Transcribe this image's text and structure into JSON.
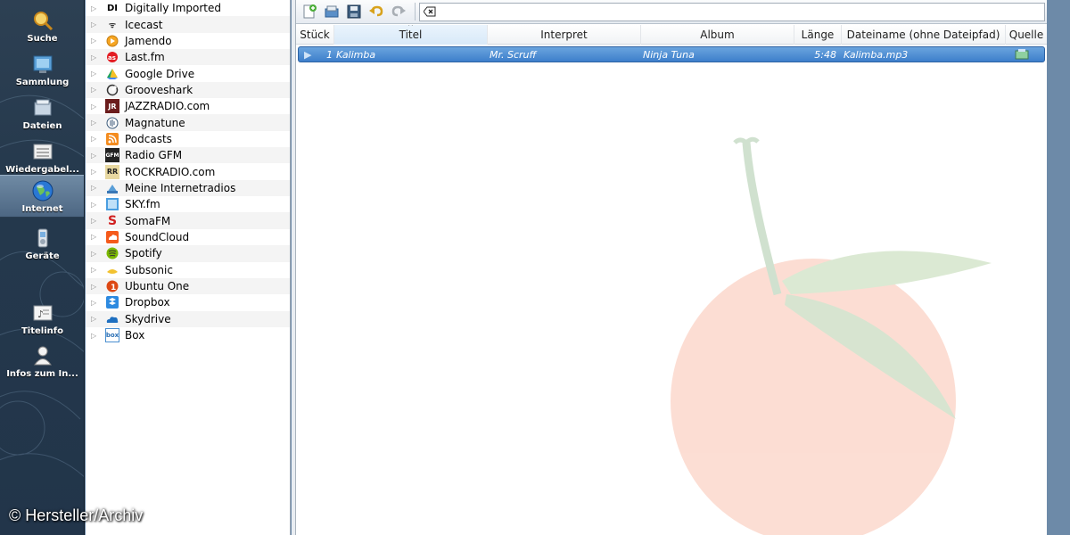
{
  "sidebar": {
    "items": [
      {
        "label": "Suche",
        "icon": "search-icon"
      },
      {
        "label": "Sammlung",
        "icon": "collection-icon"
      },
      {
        "label": "Dateien",
        "icon": "files-icon"
      },
      {
        "label": "Wiedergabel...",
        "icon": "playlist-icon"
      },
      {
        "label": "Internet",
        "icon": "globe-icon",
        "active": true
      },
      {
        "label": "Geräte",
        "icon": "device-icon"
      },
      {
        "label": "Titelinfo",
        "icon": "song-info-icon"
      },
      {
        "label": "Infos zum In...",
        "icon": "artist-info-icon"
      }
    ]
  },
  "tree": {
    "items": [
      {
        "label": "Digitally Imported",
        "icon": "digitally-imported-icon"
      },
      {
        "label": "Icecast",
        "icon": "icecast-icon"
      },
      {
        "label": "Jamendo",
        "icon": "jamendo-icon"
      },
      {
        "label": "Last.fm",
        "icon": "lastfm-icon"
      },
      {
        "label": "Google Drive",
        "icon": "google-drive-icon"
      },
      {
        "label": "Grooveshark",
        "icon": "grooveshark-icon"
      },
      {
        "label": "JAZZRADIO.com",
        "icon": "jazzradio-icon"
      },
      {
        "label": "Magnatune",
        "icon": "magnatune-icon"
      },
      {
        "label": "Podcasts",
        "icon": "podcast-icon"
      },
      {
        "label": "Radio GFM",
        "icon": "radio-gfm-icon"
      },
      {
        "label": "ROCKRADIO.com",
        "icon": "rockradio-icon"
      },
      {
        "label": "Meine Internetradios",
        "icon": "my-radios-icon"
      },
      {
        "label": "SKY.fm",
        "icon": "skyfm-icon"
      },
      {
        "label": "SomaFM",
        "icon": "somafm-icon"
      },
      {
        "label": "SoundCloud",
        "icon": "soundcloud-icon"
      },
      {
        "label": "Spotify",
        "icon": "spotify-icon"
      },
      {
        "label": "Subsonic",
        "icon": "subsonic-icon"
      },
      {
        "label": "Ubuntu One",
        "icon": "ubuntu-one-icon"
      },
      {
        "label": "Dropbox",
        "icon": "dropbox-icon"
      },
      {
        "label": "Skydrive",
        "icon": "skydrive-icon"
      },
      {
        "label": "Box",
        "icon": "box-icon"
      }
    ]
  },
  "playlist": {
    "columns": [
      "Stück",
      "Titel",
      "Interpret",
      "Album",
      "Länge",
      "Dateiname (ohne Dateipfad)",
      "Quelle"
    ],
    "sorted_column": "Titel",
    "rows": [
      {
        "track": "1",
        "title": "Kalimba",
        "artist": "Mr. Scruff",
        "album": "Ninja Tuna",
        "length": "5:48",
        "filename": "Kalimba.mp3"
      }
    ]
  },
  "watermark": "© Hersteller/Archiv",
  "colors": {
    "selection": "#3d7fcb",
    "sidebar": "#24384c"
  }
}
